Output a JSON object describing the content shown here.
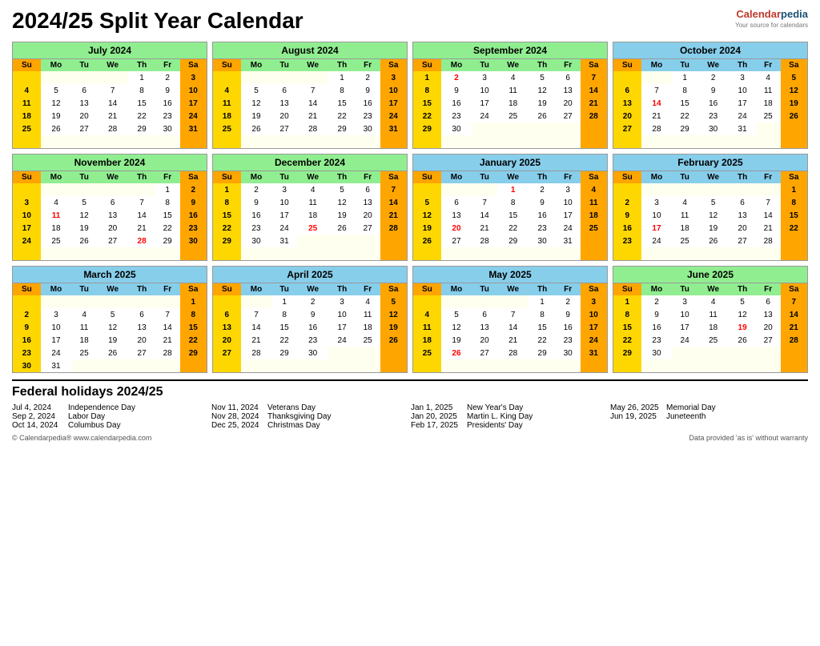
{
  "title": "2024/25 Split Year Calendar",
  "logo": {
    "calendar": "Calendar",
    "pedia": "pedia",
    "tagline": "Your source for calendars"
  },
  "months": [
    {
      "name": "July 2024",
      "titleColor": "green",
      "headerColor": "green",
      "weeks": [
        [
          "",
          "1",
          "2",
          "3",
          "4*",
          "5",
          "6"
        ],
        [
          "7",
          "8",
          "9",
          "10",
          "11",
          "12",
          "13"
        ],
        [
          "14",
          "15",
          "16",
          "17",
          "18",
          "19",
          "20"
        ],
        [
          "21",
          "22",
          "23",
          "24",
          "25",
          "26",
          "27"
        ],
        [
          "28",
          "29",
          "30",
          "31",
          "",
          "",
          ""
        ]
      ],
      "redDays": [
        [
          "0-3"
        ]
      ],
      "boldSa": [
        [
          "0-6",
          "1-6",
          "2-6",
          "3-6"
        ]
      ]
    },
    {
      "name": "August 2024",
      "titleColor": "green",
      "headerColor": "green",
      "weeks": [
        [
          "",
          "",
          "",
          "",
          "1",
          "2",
          "3"
        ],
        [
          "4",
          "5",
          "6",
          "7",
          "8",
          "9",
          "10"
        ],
        [
          "11",
          "12",
          "13",
          "14",
          "15",
          "16",
          "17"
        ],
        [
          "18",
          "19",
          "20",
          "21",
          "22",
          "23",
          "24"
        ],
        [
          "25",
          "26",
          "27",
          "28",
          "29",
          "30",
          "31"
        ]
      ]
    },
    {
      "name": "September 2024",
      "titleColor": "green",
      "headerColor": "green",
      "weeks": [
        [
          "1",
          "2*",
          "3",
          "4",
          "5",
          "6",
          "7"
        ],
        [
          "8",
          "9",
          "10",
          "11",
          "12",
          "13",
          "14"
        ],
        [
          "15",
          "16",
          "17",
          "18",
          "19",
          "20",
          "21"
        ],
        [
          "22",
          "23",
          "24",
          "25",
          "26",
          "27",
          "28"
        ],
        [
          "29",
          "30",
          "",
          "",
          "",
          "",
          ""
        ]
      ],
      "redDays": [
        [
          "0-1"
        ]
      ]
    },
    {
      "name": "October 2024",
      "titleColor": "blue",
      "headerColor": "blue",
      "weeks": [
        [
          "",
          "",
          "1",
          "2",
          "3",
          "4",
          "5"
        ],
        [
          "6",
          "7",
          "8",
          "9",
          "10",
          "11",
          "12"
        ],
        [
          "13",
          "14*",
          "15",
          "16",
          "17",
          "18",
          "19"
        ],
        [
          "20",
          "21",
          "22",
          "23",
          "24",
          "25",
          "26"
        ],
        [
          "27",
          "28",
          "29",
          "30",
          "31",
          "",
          ""
        ]
      ],
      "redDays": [
        [
          "2-1"
        ]
      ]
    },
    {
      "name": "November 2024",
      "titleColor": "green",
      "headerColor": "green",
      "weeks": [
        [
          "",
          "",
          "",
          "",
          "",
          "1",
          "2"
        ],
        [
          "3",
          "4",
          "5",
          "6",
          "7",
          "8",
          "9"
        ],
        [
          "10",
          "11*",
          "12",
          "13",
          "14",
          "15",
          "16"
        ],
        [
          "17",
          "18",
          "19",
          "20",
          "21",
          "22",
          "23"
        ],
        [
          "24",
          "25",
          "26",
          "27",
          "28*",
          "29",
          "30"
        ]
      ],
      "redDays": [
        [
          "2-1"
        ],
        [
          "4-4"
        ]
      ]
    },
    {
      "name": "December 2024",
      "titleColor": "green",
      "headerColor": "green",
      "weeks": [
        [
          "1",
          "2",
          "3",
          "4",
          "5",
          "6",
          "7"
        ],
        [
          "8",
          "9",
          "10",
          "11",
          "12",
          "13",
          "14"
        ],
        [
          "15",
          "16",
          "17",
          "18",
          "19",
          "20",
          "21"
        ],
        [
          "22",
          "23",
          "24",
          "25*",
          "26",
          "27",
          "28"
        ],
        [
          "29",
          "30",
          "31",
          "",
          "",
          "",
          ""
        ]
      ],
      "redDays": [
        [
          "3-3"
        ]
      ]
    },
    {
      "name": "January 2025",
      "titleColor": "blue",
      "headerColor": "blue",
      "weeks": [
        [
          "",
          "",
          "1*",
          "2",
          "3",
          "4"
        ],
        [
          "5",
          "6",
          "7",
          "8",
          "9",
          "10",
          "11"
        ],
        [
          "12",
          "13",
          "14",
          "15",
          "16",
          "17",
          "18"
        ],
        [
          "19",
          "20*",
          "21",
          "22",
          "23",
          "24",
          "25"
        ],
        [
          "26",
          "27",
          "28",
          "29",
          "30",
          "31",
          ""
        ]
      ],
      "redDays": [
        [
          "0-2"
        ],
        [
          "3-1"
        ]
      ]
    },
    {
      "name": "February 2025",
      "titleColor": "blue",
      "headerColor": "blue",
      "weeks": [
        [
          "",
          "",
          "",
          "",
          "",
          "",
          "1"
        ],
        [
          "2",
          "3",
          "4",
          "5",
          "6",
          "7",
          "8"
        ],
        [
          "9",
          "10",
          "11",
          "12",
          "13",
          "14",
          "15"
        ],
        [
          "16",
          "17*",
          "18",
          "19",
          "20",
          "21",
          "22"
        ],
        [
          "23",
          "24",
          "25",
          "26",
          "27",
          "28",
          ""
        ]
      ],
      "redDays": [
        [
          "3-1"
        ]
      ]
    },
    {
      "name": "March 2025",
      "titleColor": "blue",
      "headerColor": "blue",
      "weeks": [
        [
          "",
          "",
          "",
          "",
          "",
          "",
          "1"
        ],
        [
          "2",
          "3",
          "4",
          "5",
          "6",
          "7",
          "8"
        ],
        [
          "9",
          "10",
          "11",
          "12",
          "13",
          "14",
          "15"
        ],
        [
          "16",
          "17",
          "18",
          "19",
          "20",
          "21",
          "22"
        ],
        [
          "23",
          "24",
          "25",
          "26",
          "27",
          "28",
          "29"
        ],
        [
          "30",
          "31",
          "",
          "",
          "",
          "",
          ""
        ]
      ]
    },
    {
      "name": "April 2025",
      "titleColor": "blue",
      "headerColor": "blue",
      "weeks": [
        [
          "",
          "1",
          "2",
          "3",
          "4",
          "5"
        ],
        [
          "6",
          "7",
          "8",
          "9",
          "10",
          "11",
          "12"
        ],
        [
          "13",
          "14",
          "15",
          "16",
          "17",
          "18",
          "19"
        ],
        [
          "20",
          "21",
          "22",
          "23",
          "24",
          "25",
          "26"
        ],
        [
          "27",
          "28",
          "29",
          "30",
          "",
          "",
          ""
        ]
      ]
    },
    {
      "name": "May 2025",
      "titleColor": "blue",
      "headerColor": "blue",
      "weeks": [
        [
          "",
          "",
          "",
          "",
          "1",
          "2",
          "3"
        ],
        [
          "4",
          "5",
          "6",
          "7",
          "8",
          "9",
          "10"
        ],
        [
          "11",
          "12",
          "13",
          "14",
          "15",
          "16",
          "17"
        ],
        [
          "18",
          "19",
          "20",
          "21",
          "22",
          "23",
          "24"
        ],
        [
          "25",
          "26*",
          "27",
          "28",
          "29",
          "30",
          "31"
        ]
      ],
      "redDays": [
        [
          "4-1"
        ]
      ]
    },
    {
      "name": "June 2025",
      "titleColor": "green",
      "headerColor": "green",
      "weeks": [
        [
          "1",
          "2",
          "3",
          "4",
          "5",
          "6",
          "7"
        ],
        [
          "8",
          "9",
          "10",
          "11",
          "12",
          "13",
          "14"
        ],
        [
          "15",
          "16",
          "17",
          "18",
          "19*",
          "20",
          "21"
        ],
        [
          "22",
          "23",
          "24",
          "25",
          "26",
          "27",
          "28"
        ],
        [
          "29",
          "30",
          "",
          "",
          "",
          "",
          ""
        ]
      ],
      "redDays": [
        [
          "2-4"
        ]
      ]
    }
  ],
  "holidays": {
    "title": "Federal holidays 2024/25",
    "columns": [
      [
        {
          "date": "Jul 4, 2024",
          "name": "Independence Day"
        },
        {
          "date": "Sep 2, 2024",
          "name": "Labor Day"
        },
        {
          "date": "Oct 14, 2024",
          "name": "Columbus Day"
        }
      ],
      [
        {
          "date": "Nov 11, 2024",
          "name": "Veterans Day"
        },
        {
          "date": "Nov 28, 2024",
          "name": "Thanksgiving Day"
        },
        {
          "date": "Dec 25, 2024",
          "name": "Christmas Day"
        }
      ],
      [
        {
          "date": "Jan 1, 2025",
          "name": "New Year's Day"
        },
        {
          "date": "Jan 20, 2025",
          "name": "Martin L. King Day"
        },
        {
          "date": "Feb 17, 2025",
          "name": "Presidents' Day"
        }
      ],
      [
        {
          "date": "May 26, 2025",
          "name": "Memorial Day"
        },
        {
          "date": "Jun 19, 2025",
          "name": "Juneteenth"
        }
      ]
    ]
  },
  "footer": {
    "copyright": "© Calendarpedia®  www.calendarpedia.com",
    "disclaimer": "Data provided 'as is' without warranty"
  }
}
